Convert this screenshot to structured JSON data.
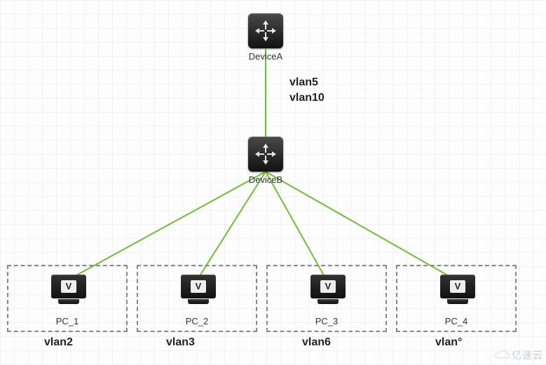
{
  "icons": {
    "device_glyph": "V",
    "pc_glyph": "V"
  },
  "devices": {
    "A": {
      "label": "DeviceA"
    },
    "B": {
      "label": "DeviceB"
    }
  },
  "trunk": {
    "line1": "vlan5",
    "line2": "vlan10"
  },
  "pcs": [
    {
      "label": "PC_1",
      "vlan": "vlan2"
    },
    {
      "label": "PC_2",
      "vlan": "vlan3"
    },
    {
      "label": "PC_3",
      "vlan": "vlan6"
    },
    {
      "label": "PC_4",
      "vlan": "vlan°"
    }
  ],
  "watermark": "亿速云",
  "chart_data": {
    "type": "network-diagram",
    "nodes": [
      {
        "id": "DeviceA",
        "type": "switch",
        "label": "DeviceA"
      },
      {
        "id": "DeviceB",
        "type": "switch",
        "label": "DeviceB"
      },
      {
        "id": "PC_1",
        "type": "pc",
        "label": "PC_1",
        "vlan": "vlan2"
      },
      {
        "id": "PC_2",
        "type": "pc",
        "label": "PC_2",
        "vlan": "vlan3"
      },
      {
        "id": "PC_3",
        "type": "pc",
        "label": "PC_3",
        "vlan": "vlan6"
      },
      {
        "id": "PC_4",
        "type": "pc",
        "label": "PC_4",
        "vlan": "vlan°"
      }
    ],
    "edges": [
      {
        "from": "DeviceA",
        "to": "DeviceB",
        "label": [
          "vlan5",
          "vlan10"
        ],
        "type": "trunk"
      },
      {
        "from": "DeviceB",
        "to": "PC_1"
      },
      {
        "from": "DeviceB",
        "to": "PC_2"
      },
      {
        "from": "DeviceB",
        "to": "PC_3"
      },
      {
        "from": "DeviceB",
        "to": "PC_4"
      }
    ],
    "vlan_groups": [
      "vlan2",
      "vlan3",
      "vlan6",
      "vlan°"
    ]
  }
}
